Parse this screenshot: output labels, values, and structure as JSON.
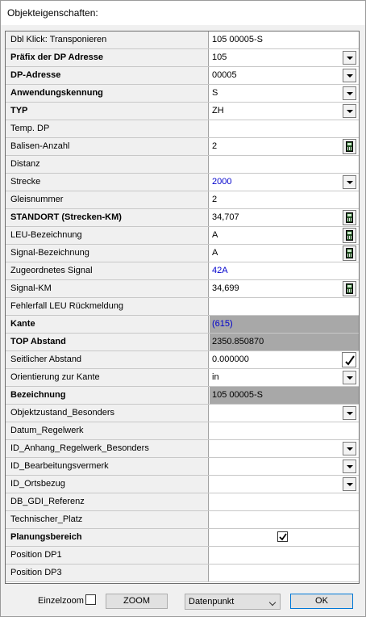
{
  "window": {
    "title": "Objekteigenschaften:"
  },
  "rows": [
    {
      "label": "Dbl Klick: Transponieren",
      "value": "105 00005-S",
      "bold": false,
      "control": "none",
      "value_style": ""
    },
    {
      "label": "Präfix der DP Adresse",
      "value": "105",
      "bold": true,
      "control": "dropdown",
      "value_style": ""
    },
    {
      "label": "DP-Adresse",
      "value": "00005",
      "bold": true,
      "control": "dropdown",
      "value_style": ""
    },
    {
      "label": "Anwendungskennung",
      "value": "S",
      "bold": true,
      "control": "dropdown",
      "value_style": ""
    },
    {
      "label": "TYP",
      "value": "ZH",
      "bold": true,
      "control": "dropdown",
      "value_style": ""
    },
    {
      "label": "Temp. DP",
      "value": "",
      "bold": false,
      "control": "none",
      "value_style": ""
    },
    {
      "label": "Balisen-Anzahl",
      "value": "2",
      "bold": false,
      "control": "calculator",
      "value_style": ""
    },
    {
      "label": "Distanz",
      "value": "",
      "bold": false,
      "control": "none",
      "value_style": ""
    },
    {
      "label": "Strecke",
      "value": "2000",
      "bold": false,
      "control": "dropdown",
      "value_style": "blue"
    },
    {
      "label": "Gleisnummer",
      "value": "2",
      "bold": false,
      "control": "none",
      "value_style": ""
    },
    {
      "label": "STANDORT (Strecken-KM)",
      "value": "34,707",
      "bold": true,
      "control": "calculator",
      "value_style": ""
    },
    {
      "label": "LEU-Bezeichnung",
      "value": "A",
      "bold": false,
      "control": "calculator",
      "value_style": ""
    },
    {
      "label": "Signal-Bezeichnung",
      "value": "A",
      "bold": false,
      "control": "calculator",
      "value_style": ""
    },
    {
      "label": "Zugeordnetes Signal",
      "value": "42A",
      "bold": false,
      "control": "none",
      "value_style": "blue"
    },
    {
      "label": "Signal-KM",
      "value": "34,699",
      "bold": false,
      "control": "calculator",
      "value_style": ""
    },
    {
      "label": "Fehlerfall LEU Rückmeldung",
      "value": "",
      "bold": false,
      "control": "none",
      "value_style": ""
    },
    {
      "label": "Kante",
      "value": "(615)",
      "bold": true,
      "control": "none",
      "value_style": "blue gray"
    },
    {
      "label": "TOP Abstand",
      "value": "2350.850870",
      "bold": true,
      "control": "none",
      "value_style": "gray"
    },
    {
      "label": "Seitlicher Abstand",
      "value": "0.000000",
      "bold": false,
      "control": "check",
      "value_style": ""
    },
    {
      "label": "Orientierung zur Kante",
      "value": "in",
      "bold": false,
      "control": "dropdown",
      "value_style": ""
    },
    {
      "label": "Bezeichnung",
      "value": "105 00005-S",
      "bold": true,
      "control": "none",
      "value_style": "gray"
    },
    {
      "label": "Objektzustand_Besonders",
      "value": "",
      "bold": false,
      "control": "dropdown",
      "value_style": ""
    },
    {
      "label": "Datum_Regelwerk",
      "value": "",
      "bold": false,
      "control": "none",
      "value_style": ""
    },
    {
      "label": "ID_Anhang_Regelwerk_Besonders",
      "value": "",
      "bold": false,
      "control": "dropdown",
      "value_style": ""
    },
    {
      "label": "ID_Bearbeitungsvermerk",
      "value": "",
      "bold": false,
      "control": "dropdown",
      "value_style": ""
    },
    {
      "label": "ID_Ortsbezug",
      "value": "",
      "bold": false,
      "control": "dropdown",
      "value_style": ""
    },
    {
      "label": "DB_GDI_Referenz",
      "value": "",
      "bold": false,
      "control": "none",
      "value_style": ""
    },
    {
      "label": "Technischer_Platz",
      "value": "",
      "bold": false,
      "control": "none",
      "value_style": ""
    },
    {
      "label": "Planungsbereich",
      "value": "",
      "bold": true,
      "control": "checkbox-checked",
      "value_style": ""
    },
    {
      "label": "Position DP1",
      "value": "",
      "bold": false,
      "control": "none",
      "value_style": ""
    },
    {
      "label": "Position DP3",
      "value": "",
      "bold": false,
      "control": "none",
      "value_style": ""
    }
  ],
  "footer": {
    "einzelzoom_label": "Einzelzoom",
    "zoom_button": "ZOOM",
    "mode_select": "Datenpunkt",
    "ok_button": "OK"
  },
  "colors": {
    "link_blue": "#0000cc",
    "readonly_gray": "#a8a8a8",
    "label_bg": "#f0f0f0"
  }
}
